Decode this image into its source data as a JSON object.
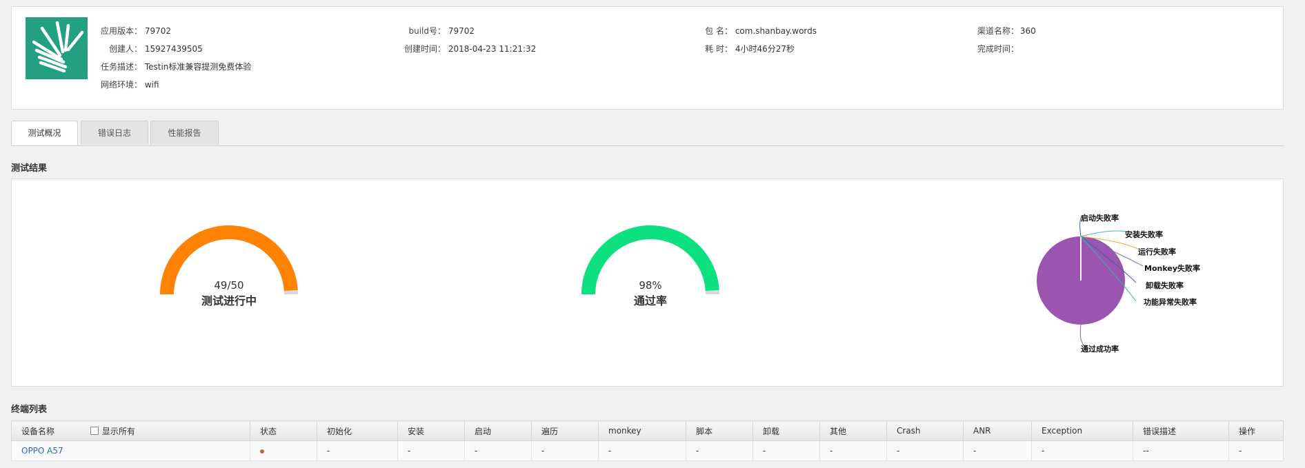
{
  "info": {
    "app_version_label": "应用版本：",
    "app_version": "79702",
    "creator_label": "创建人：",
    "creator": "15927439505",
    "task_desc_label": "任务描述：",
    "task_desc": "Testin标准兼容提测免费体验",
    "network_label": "网络环境：",
    "network": "wifi",
    "build_label": "build号：",
    "build": "79702",
    "created_time_label": "创建时间：",
    "created_time": "2018-04-23 11:21:32",
    "package_label": "包 名：",
    "package": "com.shanbay.words",
    "duration_label": "耗 时：",
    "duration": "4小时46分27秒",
    "channel_label": "渠道名称：",
    "channel": "360",
    "finish_time_label": "完成时间：",
    "finish_time": ""
  },
  "tabs": [
    "测试概况",
    "错误日志",
    "性能报告"
  ],
  "results_title": "测试结果",
  "gauge_progress": {
    "value_text": "49/50",
    "label": "测试进行中",
    "fraction": 0.98,
    "color": "#ff8204"
  },
  "gauge_pass": {
    "value_text": "98%",
    "label": "通过率",
    "fraction": 0.98,
    "color": "#0ce07f"
  },
  "pie": {
    "color": "#9b55b0",
    "labels": [
      "启动失败率",
      "安装失败率",
      "运行失败率",
      "Monkey失败率",
      "卸载失败率",
      "功能异常失败率",
      "通过成功率"
    ],
    "line_colors": [
      "#3b5ba8",
      "#41b3d9",
      "#f2a531",
      "#7a6fb5",
      "#3a64a8",
      "#2ab89c",
      "#9b55b0"
    ]
  },
  "device_list_title": "终端列表",
  "table": {
    "show_all_label": "显示所有",
    "headers": [
      "设备名称",
      "状态",
      "初始化",
      "安装",
      "启动",
      "遍历",
      "monkey",
      "脚本",
      "卸载",
      "其他",
      "Crash",
      "ANR",
      "Exception",
      "错误描述",
      "操作"
    ],
    "rows": [
      {
        "device": "OPPO A57",
        "cells": [
          "-",
          "-",
          "-",
          "-",
          "-",
          "-",
          "-",
          "-",
          "-",
          "-",
          "-",
          "--",
          "-"
        ]
      }
    ]
  }
}
